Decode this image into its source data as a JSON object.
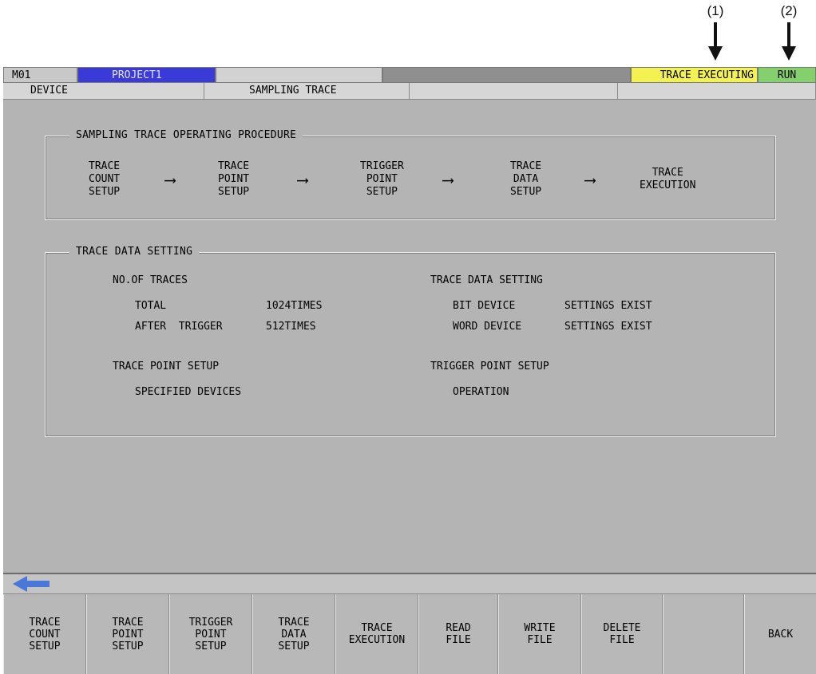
{
  "callouts": [
    {
      "label": "(1)"
    },
    {
      "label": "(2)"
    }
  ],
  "status_bar": {
    "station": "M01",
    "project": "PROJECT1",
    "trace_status": "TRACE EXECUTING",
    "cpu_status": "RUN",
    "colors": {
      "project": "#3a3ad8",
      "trace_status": "#f4f250",
      "cpu_status": "#84d06c"
    }
  },
  "breadcrumb": {
    "device": "DEVICE",
    "sampling_trace": "SAMPLING TRACE"
  },
  "procedure": {
    "title": "SAMPLING TRACE OPERATING PROCEDURE",
    "steps": [
      "TRACE\nCOUNT\nSETUP",
      "TRACE\nPOINT\nSETUP",
      "TRIGGER\nPOINT\nSETUP",
      "TRACE\nDATA\nSETUP",
      "TRACE\nEXECUTION"
    ],
    "arrow": "⟶"
  },
  "data_setting": {
    "title": "TRACE DATA SETTING",
    "no_of_traces": {
      "heading": "NO.OF TRACES",
      "total_label": "TOTAL",
      "total_value": "1024TIMES",
      "after_trigger_label": "AFTER  TRIGGER",
      "after_trigger_value": "512TIMES"
    },
    "trace_data": {
      "heading": "TRACE DATA SETTING",
      "bit_label": "BIT DEVICE",
      "bit_value": "SETTINGS EXIST",
      "word_label": "WORD DEVICE",
      "word_value": "SETTINGS EXIST"
    },
    "trace_point": {
      "heading": "TRACE POINT SETUP",
      "value": "SPECIFIED DEVICES"
    },
    "trigger_point": {
      "heading": "TRIGGER POINT SETUP",
      "value": "OPERATION"
    }
  },
  "back_arrow_icon": "left-arrow-icon",
  "function_keys": [
    "TRACE\nCOUNT\nSETUP",
    "TRACE\nPOINT\nSETUP",
    "TRIGGER\nPOINT\nSETUP",
    "TRACE\nDATA\nSETUP",
    "TRACE\nEXECUTION",
    "READ\nFILE",
    "WRITE\nFILE",
    "DELETE\nFILE",
    "",
    "BACK"
  ]
}
